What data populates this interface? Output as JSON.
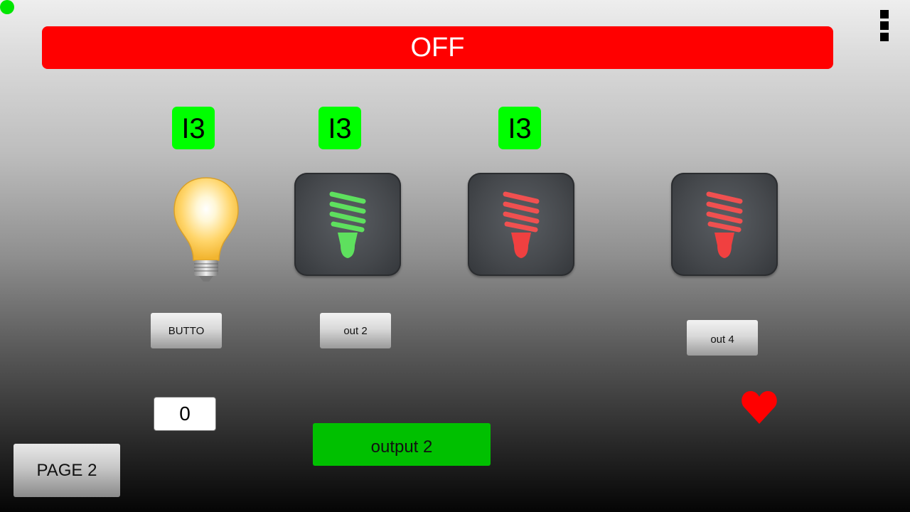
{
  "colors": {
    "status_dot": "#00e600",
    "banner_off": "#ff0000",
    "indicator_green": "#00ff00",
    "output_green": "#00c000",
    "bulb_green": "#5ee05e",
    "bulb_red": "#f04a4a",
    "heart": "#ff0000"
  },
  "banner": {
    "text": "OFF"
  },
  "indicators": [
    {
      "label": "I3"
    },
    {
      "label": "I3"
    },
    {
      "label": "I3"
    }
  ],
  "lamps": [
    {
      "icon": "incandescent-bulb-lit-icon"
    },
    {
      "icon": "cfl-bulb-green-icon"
    },
    {
      "icon": "cfl-bulb-red-icon"
    },
    {
      "icon": "cfl-bulb-red-icon"
    }
  ],
  "buttons": {
    "button1": "BUTTO",
    "out2": "out 2",
    "out4": "out 4",
    "output2": "output 2",
    "page2": "PAGE 2"
  },
  "counter": {
    "value": "0"
  },
  "icons": {
    "menu": "overflow-menu-icon",
    "heart": "heart-icon",
    "status": "status-dot-icon"
  }
}
